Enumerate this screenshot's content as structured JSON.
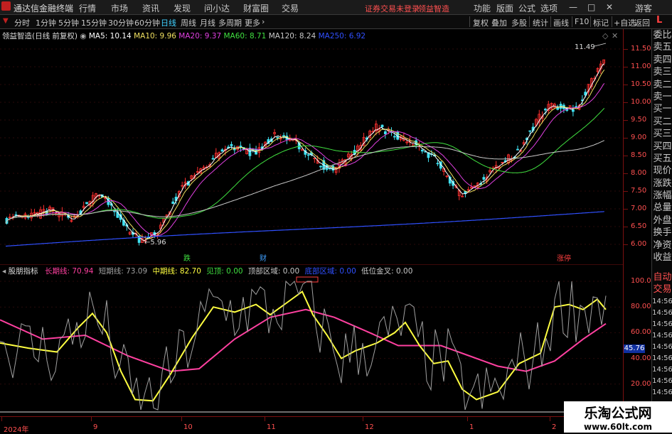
{
  "menubar": {
    "app_title": "通达信金融终端",
    "menu": [
      "行情",
      "市场",
      "资讯",
      "发现",
      "问小达",
      "财富圈",
      "交易"
    ],
    "notice": "证券交易未登录",
    "stock_link": "领益智造",
    "right_menu": [
      "功能",
      "版面",
      "公式",
      "选项"
    ],
    "guest": "游客",
    "window_buttons": [
      "—",
      "□",
      "✕"
    ]
  },
  "tabbar": {
    "periods": [
      "分时",
      "1分钟",
      "5分钟",
      "15分钟",
      "30分钟",
      "60分钟",
      "日线",
      "周线",
      "月线",
      "多周期",
      "更多"
    ],
    "active_period": "日线",
    "tools": [
      "复权",
      "叠加",
      "多股",
      "统计",
      "画线",
      "F10",
      "标记",
      "+自选",
      "返回"
    ]
  },
  "kline": {
    "stock_label": "领益智造(日线 前复权)",
    "ma": [
      {
        "label": "MA5: 10.14",
        "color": "#ffffff"
      },
      {
        "label": "MA10: 9.96",
        "color": "#f0e060"
      },
      {
        "label": "MA20: 9.37",
        "color": "#e040e0"
      },
      {
        "label": "MA60: 8.71",
        "color": "#40e040"
      },
      {
        "label": "MA120: 8.24",
        "color": "#c8c8c8"
      },
      {
        "label": "MA250: 6.92",
        "color": "#3050ff"
      }
    ],
    "high_marker": "11.49",
    "low_marker": "5.96",
    "ylim": [
      5.7,
      11.9
    ],
    "price_ticks": [
      "11.50",
      "11.00",
      "10.50",
      "10.00",
      "9.50",
      "9.00",
      "8.50",
      "8.00",
      "7.50",
      "7.00",
      "6.50",
      "6.00"
    ],
    "event_labels": [
      {
        "text": "跌",
        "color": "#40e040"
      },
      {
        "text": "财",
        "color": "#40a0ff"
      },
      {
        "text": "涨停",
        "color": "#ff4040"
      }
    ],
    "up_color": "#ff3030",
    "down_color": "#40e0f0"
  },
  "oscillator": {
    "name": "股朋指标",
    "legend": [
      {
        "label": "长期线: 70.94",
        "color": "#ff40a0"
      },
      {
        "label": "短期线: 73.09",
        "color": "#a0a0a0"
      },
      {
        "label": "中期线: 82.70",
        "color": "#ffff40"
      },
      {
        "label": "见顶: 0.00",
        "color": "#40e040"
      },
      {
        "label": "顶部区域: 0.00",
        "color": "#c8c8c8"
      },
      {
        "label": "底部区域: 0.00",
        "color": "#3050ff"
      },
      {
        "label": "低位金叉: 0.00",
        "color": "#c8c8c8"
      }
    ],
    "ticks": [
      "100.00",
      "80.00",
      "60.00",
      "40.00",
      "20.00"
    ],
    "current_value": "45.76"
  },
  "right_panel": {
    "items": [
      "委比",
      "卖五",
      "卖四",
      "卖三",
      "卖二",
      "卖一",
      "买一",
      "买二",
      "买三",
      "买四",
      "买五",
      "现价",
      "涨跌",
      "涨幅",
      "总量",
      "外盘",
      "换手",
      "净资",
      "收益"
    ],
    "lower_items": [
      "自动",
      "交易"
    ],
    "lower_times": [
      "14:56",
      "14:56",
      "14:56",
      "14:56",
      "14:56",
      "14:56",
      "14:56",
      "14:56",
      "14:56"
    ]
  },
  "time_axis": {
    "labels": [
      "2024年",
      "9",
      "10",
      "11",
      "12",
      "1",
      "2"
    ]
  },
  "watermark": {
    "title": "乐淘公式网",
    "url": "www.60lt.com"
  }
}
